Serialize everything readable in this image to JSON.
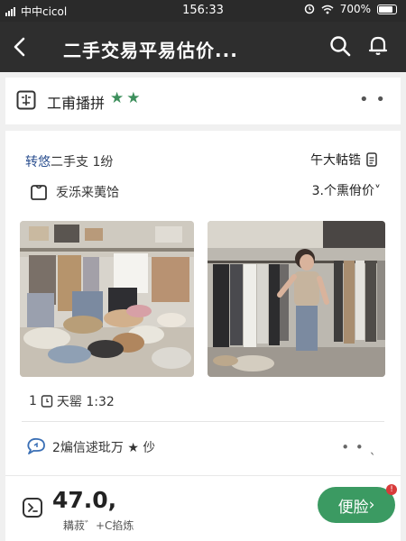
{
  "status_bar": {
    "carrier": "中中cicol",
    "time": "156:33",
    "battery": "700%"
  },
  "nav": {
    "title": "二手交易平易估价..."
  },
  "header": {
    "shop_name": "工甫播拼",
    "stars": "★★",
    "more": "• •"
  },
  "listing": {
    "row1_blue": "转悠",
    "row1_rest": "二手支 1纷",
    "row1_right": "午大軲锆",
    "row2_left": "叐泺来荑饸",
    "row2_right": "3.个熏佾价˅",
    "meta_count": "1",
    "meta_label": "天罂 1:32"
  },
  "seller": {
    "text": "2煸信逑玭万 ★ 仯",
    "more": "• • ˎ"
  },
  "footer": {
    "price": "47.0,",
    "price_sub": "耩菽゛+C掐炼",
    "cta_label": "便脸",
    "cta_arrow": "›",
    "badge": "!"
  },
  "colors": {
    "nav_bg": "#2e2e2e",
    "accent_green": "#3b9a62",
    "star_green": "#3d8f5c",
    "link_blue": "#2b4f8f",
    "badge_red": "#d83a3a"
  },
  "icons": [
    "back-arrow-icon",
    "search-icon",
    "bell-icon",
    "shop-icon",
    "star-icon",
    "document-icon",
    "bag-icon",
    "clock-icon",
    "chat-icon",
    "return-icon"
  ]
}
